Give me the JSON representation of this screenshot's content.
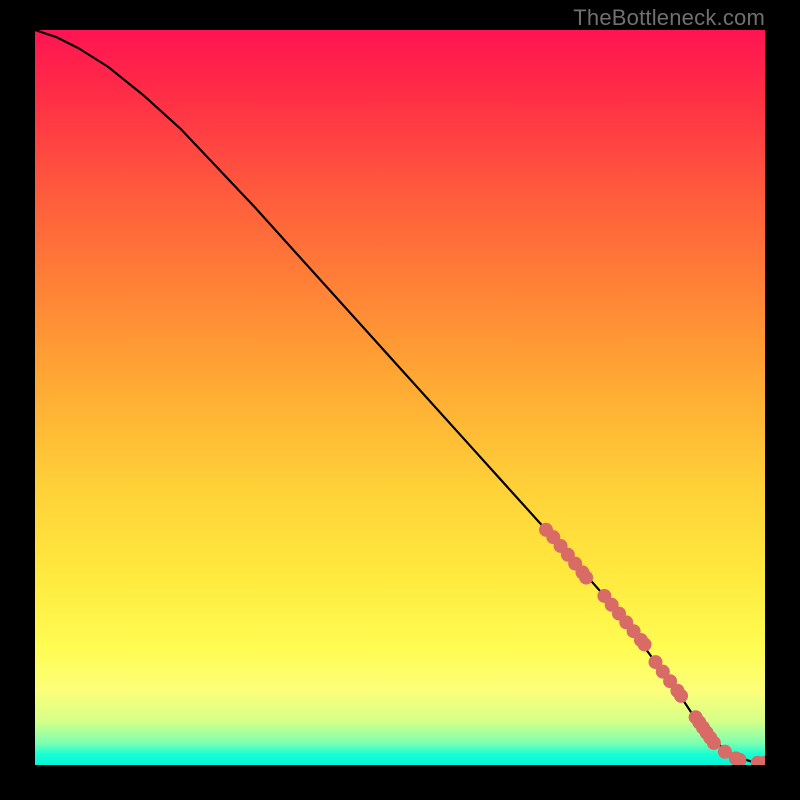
{
  "watermark": "TheBottleneck.com",
  "chart_data": {
    "type": "line",
    "title": "",
    "xlabel": "",
    "ylabel": "",
    "xlim": [
      0,
      100
    ],
    "ylim": [
      0,
      100
    ],
    "series": [
      {
        "name": "curve",
        "kind": "line",
        "color": "#000000",
        "x": [
          0,
          3,
          6,
          10,
          15,
          20,
          30,
          40,
          50,
          60,
          70,
          78,
          82,
          85,
          88,
          90,
          92,
          94,
          96,
          98,
          100
        ],
        "y": [
          100,
          99,
          97.5,
          95,
          91,
          86.5,
          76,
          65,
          54,
          43,
          32,
          23,
          18,
          14,
          10,
          7,
          4.5,
          2.5,
          1.2,
          0.5,
          0.3
        ]
      },
      {
        "name": "points",
        "kind": "scatter",
        "color": "#d86b66",
        "x": [
          70,
          71,
          72,
          73,
          74,
          75,
          75.5,
          78,
          79,
          80,
          81,
          82,
          83,
          83.5,
          85,
          86,
          87,
          88,
          88.5,
          90.5,
          91,
          91.5,
          92,
          92.5,
          93,
          94.5,
          96,
          96.5,
          99,
          100
        ],
        "y": [
          32,
          31,
          29.8,
          28.6,
          27.4,
          26.2,
          25.5,
          23,
          21.8,
          20.6,
          19.4,
          18.2,
          17,
          16.4,
          14,
          12.7,
          11.4,
          10.1,
          9.4,
          6.5,
          5.8,
          5.1,
          4.4,
          3.7,
          3,
          1.8,
          0.9,
          0.7,
          0.3,
          0.3
        ]
      }
    ]
  },
  "colors": {
    "gradient_top": "#ff1452",
    "gradient_mid": "#ffe93e",
    "gradient_bottom": "#00f7d9",
    "point": "#d86b66",
    "curve": "#000000",
    "frame": "#000000"
  }
}
